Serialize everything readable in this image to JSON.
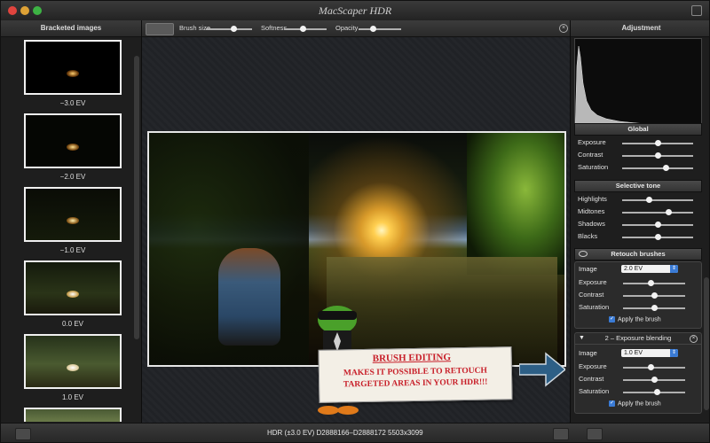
{
  "app": {
    "title": "MacScaper HDR"
  },
  "left_panel": {
    "title": "Bracketed images",
    "thumbnails": [
      {
        "label": "−3.0 EV"
      },
      {
        "label": "−2.0 EV"
      },
      {
        "label": "−1.0 EV"
      },
      {
        "label": "0.0 EV"
      },
      {
        "label": "1.0 EV"
      }
    ]
  },
  "toolbar": {
    "brush_size_label": "Brush size",
    "brush_size_level": 0.6,
    "softness_label": "Softness",
    "softness_level": 0.45,
    "opacity_label": "Opacity",
    "opacity_level": 0.35
  },
  "annotation": {
    "title": "BRUSH EDITING",
    "line1": "MAKES IT POSSIBLE TO RETOUCH",
    "line2": "TARGETED AREAS IN YOUR HDR!!!"
  },
  "right_panel": {
    "title": "Adjustment",
    "global": {
      "title": "Global",
      "rows": [
        {
          "label": "Exposure",
          "level": 0.5
        },
        {
          "label": "Contrast",
          "level": 0.5
        },
        {
          "label": "Saturation",
          "level": 0.62
        }
      ]
    },
    "selective": {
      "title": "Selective tone",
      "rows": [
        {
          "label": "Highlights",
          "level": 0.38
        },
        {
          "label": "Midtones",
          "level": 0.65
        },
        {
          "label": "Shadows",
          "level": 0.5
        },
        {
          "label": "Blacks",
          "level": 0.5
        }
      ]
    },
    "retouch": {
      "title": "Retouch brushes",
      "brush1": {
        "image_label": "Image",
        "image_value": "2.0 EV",
        "rows": [
          {
            "label": "Exposure",
            "level": 0.45
          },
          {
            "label": "Contrast",
            "level": 0.5
          },
          {
            "label": "Saturation",
            "level": 0.5
          }
        ],
        "apply_label": "Apply the brush"
      },
      "brush2": {
        "title": "2 – Exposure blending",
        "image_label": "Image",
        "image_value": "1.0 EV",
        "rows": [
          {
            "label": "Exposure",
            "level": 0.45
          },
          {
            "label": "Contrast",
            "level": 0.5
          },
          {
            "label": "Saturation",
            "level": 0.55
          }
        ],
        "apply_label": "Apply the brush"
      }
    }
  },
  "status_bar": {
    "text": "HDR (±3.0 EV) D2888166–D2888172 5503x3099"
  },
  "colors": {
    "accent": "#3a7bd5",
    "sign_text": "#c8202a",
    "window_bg": "#252525"
  }
}
